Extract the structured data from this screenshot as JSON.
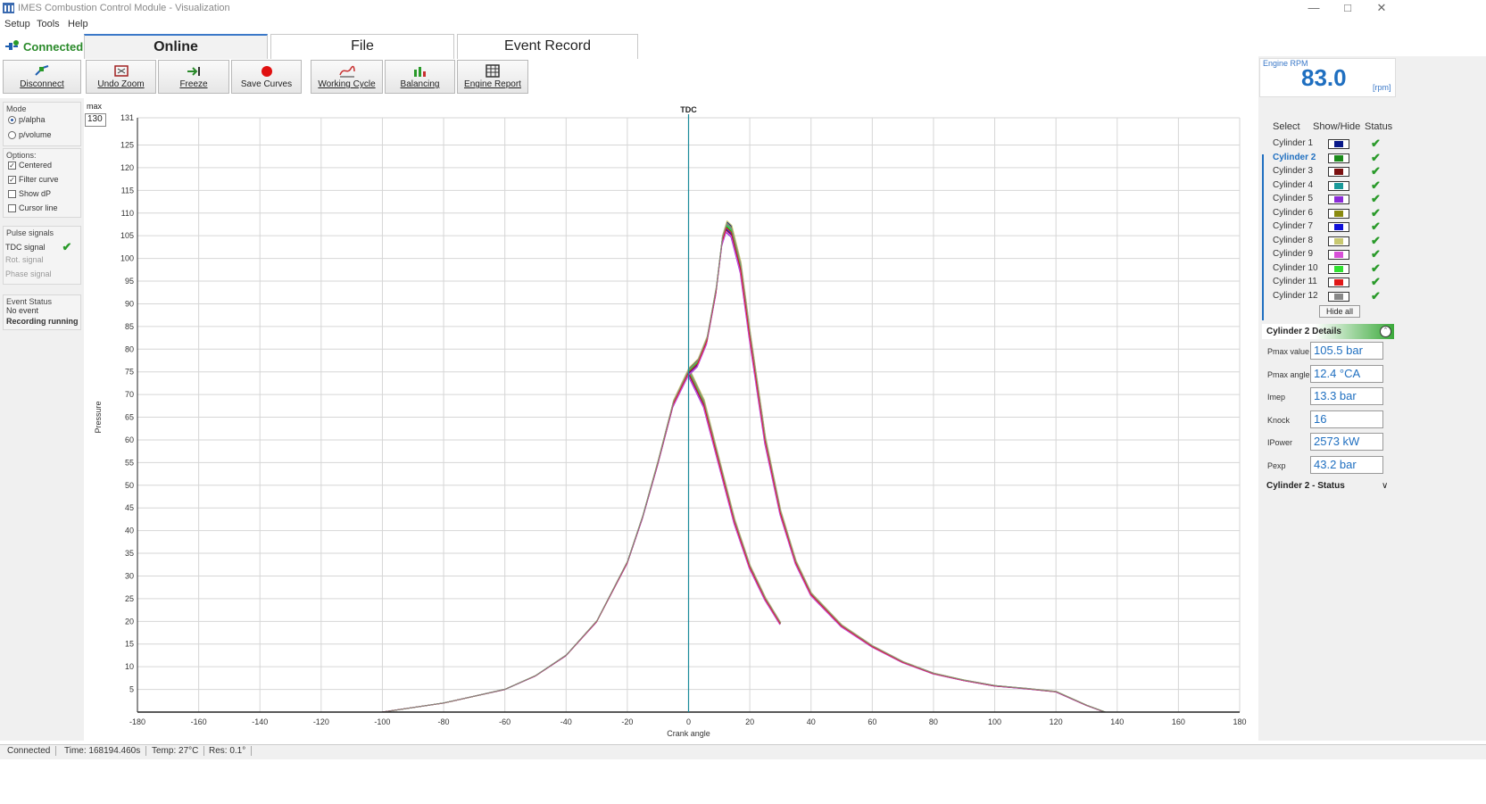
{
  "window": {
    "title": "IMES Combustion Control Module - Visualization"
  },
  "menu": [
    "Setup",
    "Tools",
    "Help"
  ],
  "connection": {
    "status": "Connected"
  },
  "tabs": [
    "Online",
    "File",
    "Event Record"
  ],
  "toolbar": {
    "disconnect": "Disconnect",
    "undo_zoom": "Undo Zoom",
    "freeze": "Freeze",
    "save_curves": "Save Curves",
    "working_cycle": "Working Cycle",
    "balancing": "Balancing",
    "engine_report": "Engine Report"
  },
  "left": {
    "mode_title": "Mode",
    "mode_options": [
      "p/alpha",
      "p/volume"
    ],
    "options_title": "Options:",
    "options": [
      {
        "label": "Centered",
        "checked": true
      },
      {
        "label": "Filter curve",
        "checked": true
      },
      {
        "label": "Show dP",
        "checked": false
      },
      {
        "label": "Cursor line",
        "checked": false
      }
    ],
    "pulse_title": "Pulse signals",
    "pulses": [
      "TDC signal",
      "Rot. signal",
      "Phase signal"
    ],
    "event_title": "Event Status",
    "event_lines": [
      "No event",
      "Recording running"
    ]
  },
  "plot": {
    "max_label": "max",
    "max_value": "130"
  },
  "engine": {
    "rpm_label": "Engine RPM",
    "rpm_value": "83.0",
    "rpm_unit": "[rpm]"
  },
  "cylinders": {
    "headers": [
      "Select",
      "Show/Hide",
      "Status"
    ],
    "items": [
      {
        "name": "Cylinder 1",
        "color": "#0a1a8a"
      },
      {
        "name": "Cylinder 2",
        "color": "#1a8a1a"
      },
      {
        "name": "Cylinder 3",
        "color": "#7a1010"
      },
      {
        "name": "Cylinder 4",
        "color": "#1a9a9a"
      },
      {
        "name": "Cylinder 5",
        "color": "#8a2ad8"
      },
      {
        "name": "Cylinder 6",
        "color": "#8a8a10"
      },
      {
        "name": "Cylinder 7",
        "color": "#1010d8"
      },
      {
        "name": "Cylinder 8",
        "color": "#c8c870"
      },
      {
        "name": "Cylinder 9",
        "color": "#d850d8"
      },
      {
        "name": "Cylinder 10",
        "color": "#30e030"
      },
      {
        "name": "Cylinder 11",
        "color": "#e01818"
      },
      {
        "name": "Cylinder 12",
        "color": "#888888"
      }
    ],
    "hide_all": "Hide all",
    "selected_index": 1
  },
  "details": {
    "title": "Cylinder 2   Details",
    "rows": [
      {
        "label": "Pmax value",
        "value": "105.5 bar"
      },
      {
        "label": "Pmax angle",
        "value": "12.4 °CA"
      },
      {
        "label": "Imep",
        "value": "13.3 bar"
      },
      {
        "label": "Knock",
        "value": "16"
      },
      {
        "label": "IPower",
        "value": "2573 kW"
      },
      {
        "label": "Pexp",
        "value": "43.2 bar"
      }
    ],
    "status_title": "Cylinder 2 - Status"
  },
  "statusbar": [
    "Connected",
    "Time: 168194.460s",
    "Temp: 27°C",
    "Res: 0.1°"
  ],
  "chart_data": {
    "type": "line",
    "title": "TDC",
    "xlabel": "Crank angle",
    "ylabel": "Pressure",
    "xlim": [
      -180,
      180
    ],
    "ylim": [
      0,
      131
    ],
    "xticks": [
      -180,
      -160,
      -140,
      -120,
      -100,
      -80,
      -60,
      -40,
      -20,
      0,
      20,
      40,
      60,
      80,
      100,
      120,
      140,
      160,
      180
    ],
    "xtick_labels": [
      "-180",
      "-160",
      "-140",
      "-120",
      "-100",
      "-80",
      "-60",
      "-40",
      "-20",
      "0",
      "20",
      "40",
      "60",
      "80",
      "100",
      "120",
      "140",
      "160",
      "180"
    ],
    "yticks": [
      5,
      10,
      15,
      20,
      25,
      30,
      35,
      40,
      45,
      50,
      55,
      60,
      65,
      70,
      75,
      80,
      85,
      90,
      95,
      100,
      105,
      110,
      115,
      120,
      125,
      131
    ],
    "ytick_labels": [
      "5",
      "10",
      "15",
      "20",
      "25",
      "30",
      "35",
      "40",
      "45",
      "50",
      "55",
      "60",
      "65",
      "70",
      "75",
      "80",
      "85",
      "90",
      "95",
      "100",
      "105",
      "110",
      "115",
      "120",
      "125",
      "131"
    ],
    "tdc_x": 0,
    "grid": true,
    "firing_curve": {
      "x": [
        -100,
        -90,
        -80,
        -70,
        -60,
        -50,
        -40,
        -30,
        -20,
        -15,
        -10,
        -5,
        0,
        3,
        6,
        9,
        11,
        12.4,
        14,
        17,
        20,
        25,
        30,
        35,
        40,
        50,
        60,
        70,
        80,
        90,
        100,
        110,
        120,
        130,
        136
      ],
      "y": [
        0,
        1,
        2,
        3.5,
        5,
        8,
        12.5,
        20,
        33,
        43,
        55,
        68,
        75,
        77,
        82,
        93,
        104,
        107,
        106,
        98,
        83,
        60,
        44,
        33,
        26,
        19,
        14.5,
        11,
        8.5,
        7,
        5.8,
        5.2,
        4.5,
        1.5,
        0
      ]
    },
    "motored_curve": {
      "x": [
        -20,
        -15,
        -10,
        -5,
        0,
        5,
        10,
        15,
        20,
        25,
        30
      ],
      "y": [
        33,
        43,
        55,
        68,
        75,
        68,
        55,
        42,
        32,
        25,
        19.5
      ]
    },
    "cylinder_offsets": [
      0.8,
      0,
      -0.6,
      0.4,
      -1.0,
      0.6,
      -0.4,
      1.0,
      -0.8,
      0.2,
      -0.2,
      0.5
    ]
  }
}
